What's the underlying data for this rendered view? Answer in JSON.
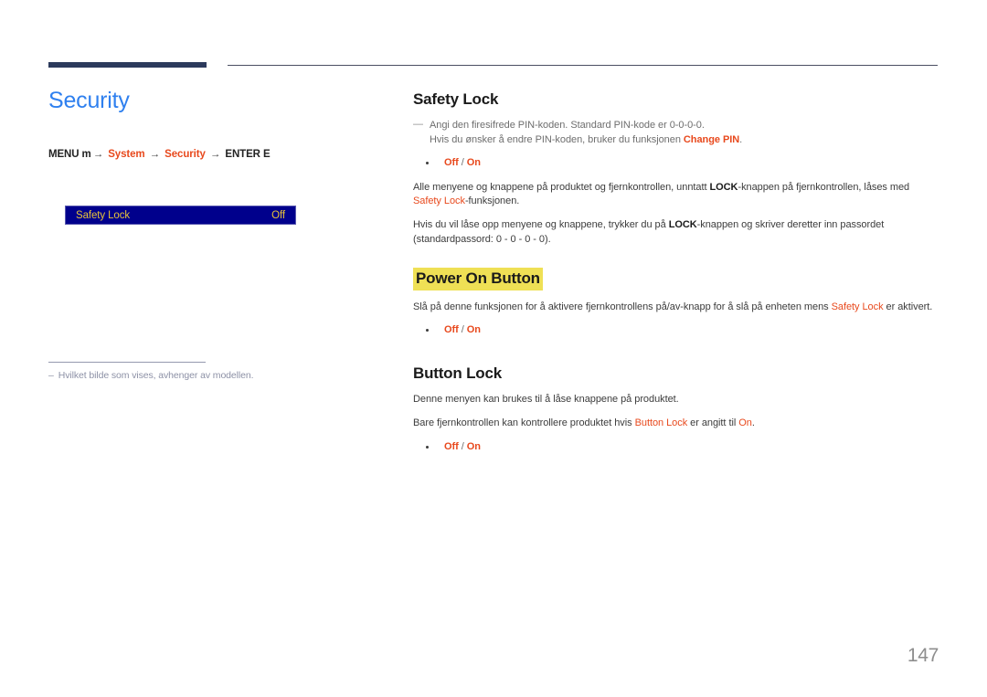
{
  "document": {
    "page_number": "147",
    "accent_color": "#e8491d",
    "title_color": "#2f80ef",
    "highlight_color": "#efe055",
    "osd_bg_color": "#00008c",
    "osd_text_color": "#e8c33a"
  },
  "left": {
    "title": "Security",
    "breadcrumb": {
      "start": "MENU m",
      "arrow": "→",
      "step1": "System",
      "step2": "Security",
      "end": "ENTER E"
    },
    "osd": {
      "label": "Safety Lock",
      "value": "Off"
    },
    "footnote": {
      "dash": "–",
      "text": "Hvilket bilde som vises, avhenger av modellen."
    }
  },
  "right": {
    "sections": [
      {
        "heading": "Safety Lock",
        "highlighted": false,
        "note": {
          "dash": "—",
          "line1": "Angi den firesifrede PIN-koden. Standard PIN-kode er 0-0-0-0.",
          "line2_pre": "Hvis du ønsker å endre PIN-koden, bruker du funksjonen ",
          "line2_accent": "Change PIN",
          "line2_post": "."
        },
        "options": {
          "off": "Off",
          "sep": " / ",
          "on": "On"
        },
        "paragraph1_pre": "Alle menyene og knappene på produktet og fjernkontrollen, unntatt ",
        "paragraph1_strong": "LOCK",
        "paragraph1_mid": "-knappen på fjernkontrollen, låses med ",
        "paragraph1_accent": "Safety Lock",
        "paragraph1_post": "-funksjonen.",
        "paragraph2_pre": "Hvis du vil låse opp menyene og knappene, trykker du på ",
        "paragraph2_strong": "LOCK",
        "paragraph2_post": "-knappen og skriver deretter inn passordet (standardpassord: 0 - 0 - 0 - 0)."
      },
      {
        "heading": "Power On Button",
        "highlighted": true,
        "paragraph_pre": "Slå på denne funksjonen for å aktivere fjernkontrollens på/av-knapp for å slå på enheten mens ",
        "paragraph_accent": "Safety Lock",
        "paragraph_post": " er aktivert.",
        "options": {
          "off": "Off",
          "sep": " / ",
          "on": "On"
        }
      },
      {
        "heading": "Button Lock",
        "highlighted": false,
        "paragraph1": "Denne menyen kan brukes til å låse knappene på produktet.",
        "paragraph2_pre": "Bare fjernkontrollen kan kontrollere produktet hvis ",
        "paragraph2_accent1": "Button Lock",
        "paragraph2_mid": " er angitt til ",
        "paragraph2_accent2": "On",
        "paragraph2_post": ".",
        "options": {
          "off": "Off",
          "sep": " / ",
          "on": "On"
        }
      }
    ]
  }
}
